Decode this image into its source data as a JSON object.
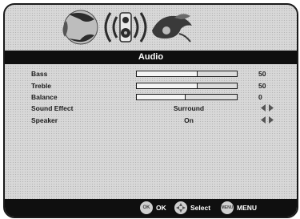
{
  "menu": {
    "title": "Audio",
    "tabs": [
      {
        "icon": "picture-settings-icon"
      },
      {
        "icon": "audio-speaker-icon"
      },
      {
        "icon": "setup-icon"
      }
    ],
    "items": [
      {
        "label": "Bass",
        "type": "slider",
        "value": "50",
        "level": 0.5
      },
      {
        "label": "Treble",
        "type": "slider",
        "value": "50",
        "level": 0.5
      },
      {
        "label": "Balance",
        "type": "slider",
        "value": "0",
        "level": 0.5
      },
      {
        "label": "Sound Effect",
        "type": "option",
        "value": "Surround"
      },
      {
        "label": "Speaker",
        "type": "option",
        "value": "On"
      }
    ]
  },
  "footer": {
    "ok_label": "OK",
    "select_label": "Select",
    "menu_label": "MENU",
    "ok_button_text": "OK",
    "menu_button_text": "MENU"
  }
}
